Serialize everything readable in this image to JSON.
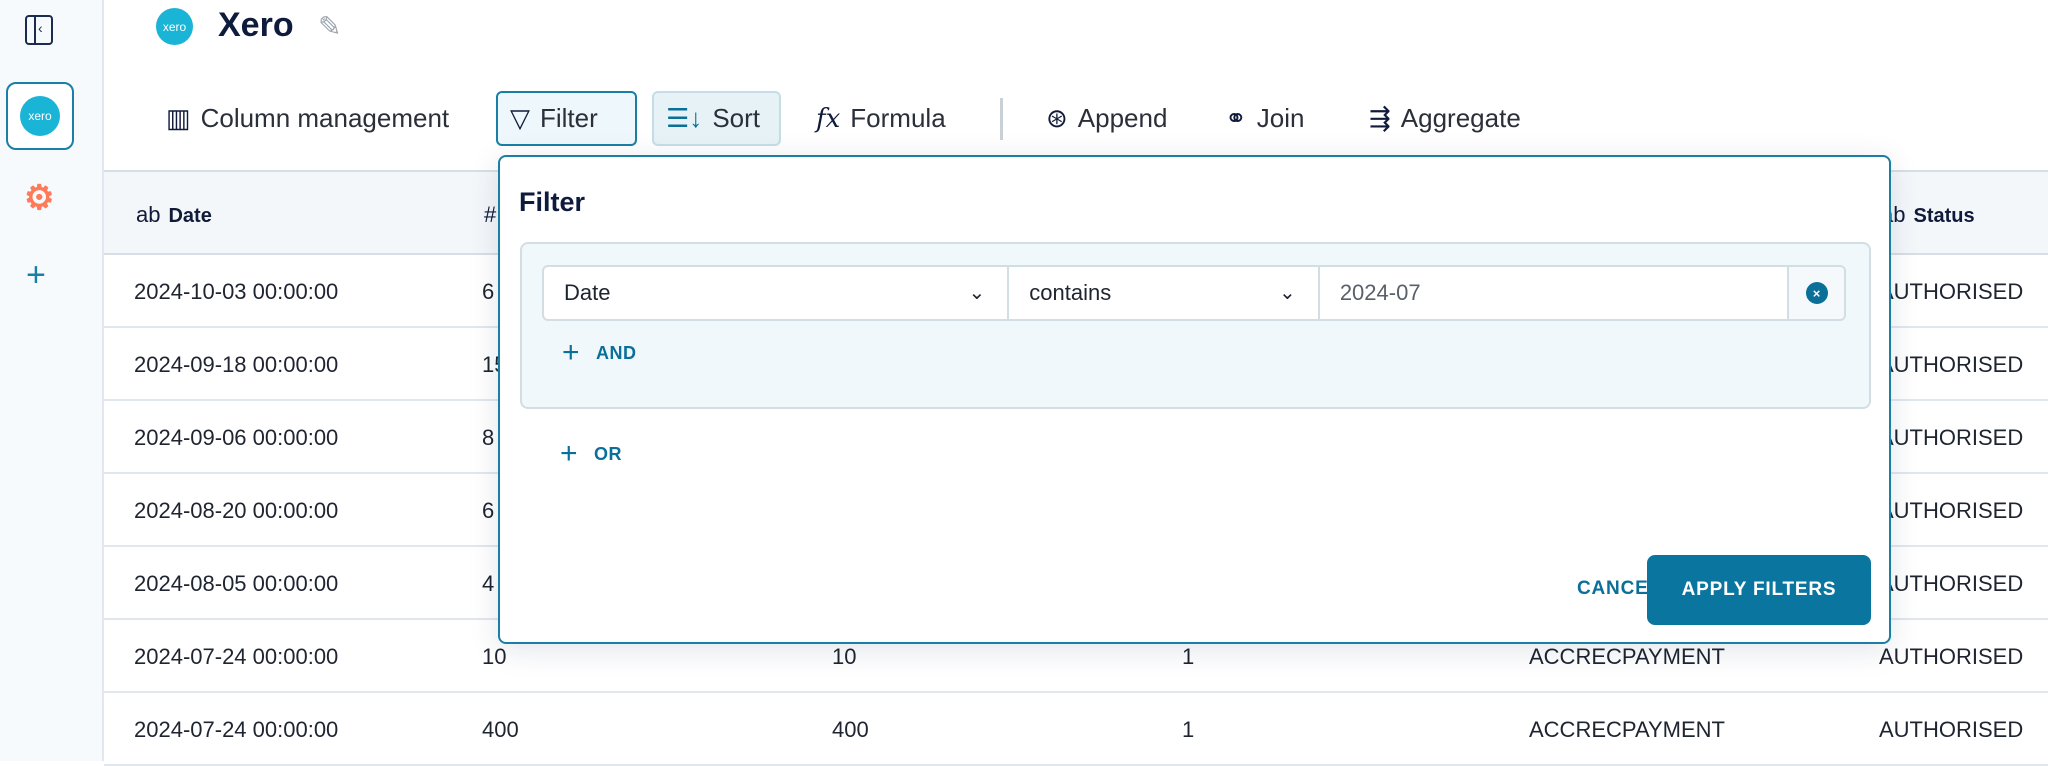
{
  "sidebar": {
    "collapse_icon": "‹",
    "sources": [
      {
        "name": "xero",
        "logo_text": "xero"
      },
      {
        "name": "hubspot"
      }
    ],
    "add": "+"
  },
  "header": {
    "logo_text": "xero",
    "title": "Xero"
  },
  "toolbar": {
    "column_management": "Column management",
    "filter": "Filter",
    "sort": "Sort",
    "formula": "Formula",
    "append": "Append",
    "join": "Join",
    "aggregate": "Aggregate"
  },
  "table": {
    "headers": [
      {
        "type": "ab",
        "label": "Date"
      },
      {
        "type": "#",
        "label": ""
      },
      {
        "type": "",
        "label": ""
      },
      {
        "type": "",
        "label": ""
      },
      {
        "type": "",
        "label": ""
      },
      {
        "type": "ab",
        "label": "Status"
      }
    ],
    "rows": [
      [
        "2024-10-03 00:00:00",
        "6",
        "",
        "",
        "",
        "AUTHORISED"
      ],
      [
        "2024-09-18 00:00:00",
        "15",
        "",
        "",
        "",
        "AUTHORISED"
      ],
      [
        "2024-09-06 00:00:00",
        "8",
        "",
        "",
        "",
        "AUTHORISED"
      ],
      [
        "2024-08-20 00:00:00",
        "6",
        "",
        "",
        "",
        "AUTHORISED"
      ],
      [
        "2024-08-05 00:00:00",
        "4",
        "",
        "",
        "",
        "AUTHORISED"
      ],
      [
        "2024-07-24 00:00:00",
        "10",
        "10",
        "1",
        "ACCRECPAYMENT",
        "AUTHORISED"
      ],
      [
        "2024-07-24 00:00:00",
        "400",
        "400",
        "1",
        "ACCRECPAYMENT",
        "AUTHORISED"
      ]
    ]
  },
  "filter": {
    "title": "Filter",
    "condition": {
      "column": "Date",
      "operator": "contains",
      "value": "2024-07"
    },
    "and_label": "AND",
    "or_label": "OR",
    "cancel": "CANCEL",
    "apply": "APPLY FILTERS"
  },
  "colors": {
    "accent": "#0a76a0",
    "xero": "#1ab4d7",
    "hubspot": "#ff7a59"
  }
}
